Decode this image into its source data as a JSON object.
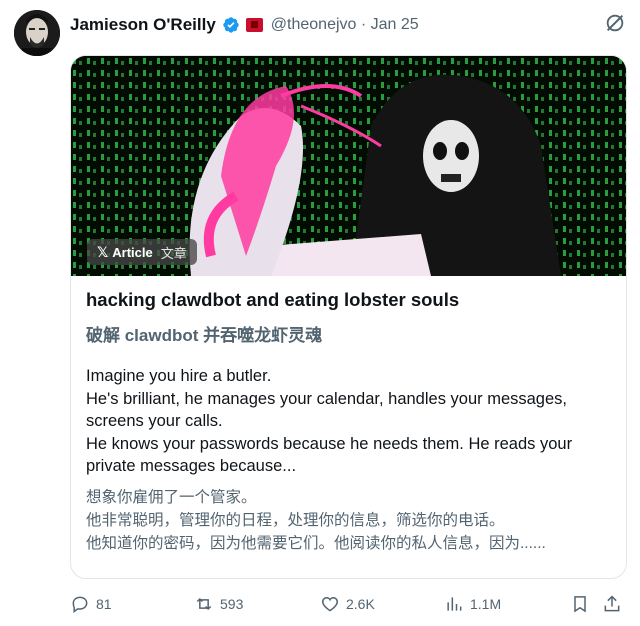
{
  "author": {
    "name": "Jamieson O'Reilly",
    "handle": "@theonejvo",
    "date": "· Jan 25"
  },
  "article": {
    "badge_label": "Article",
    "badge_label_zh": "文章",
    "title_en": "hacking clawdbot and eating lobster souls",
    "title_zh": "破解 clawdbot 并吞噬龙虾灵魂",
    "body_en": [
      "Imagine you hire a butler.",
      "He's brilliant, he manages your calendar, handles your messages,",
      "screens your calls.",
      "He knows your passwords because he needs them. He reads your",
      "private messages because..."
    ],
    "body_zh": [
      "想象你雇佣了一个管家。",
      "他非常聪明，管理你的日程，处理你的信息，筛选你的电话。",
      "他知道你的密码，因为他需要它们。他阅读你的私人信息，因为......"
    ]
  },
  "actions": {
    "replies": "81",
    "reposts": "593",
    "likes": "2.6K",
    "views": "1.1M"
  },
  "colors": {
    "accent": "#1d9bf0",
    "secondary_text": "#536471",
    "primary_text": "#0f1419",
    "border": "#e1e6ea"
  },
  "icons": [
    "verified-badge-icon",
    "flag-icon",
    "grok-icon",
    "x-logo-icon",
    "reply-icon",
    "repost-icon",
    "like-icon",
    "views-icon",
    "bookmark-icon",
    "share-icon"
  ]
}
